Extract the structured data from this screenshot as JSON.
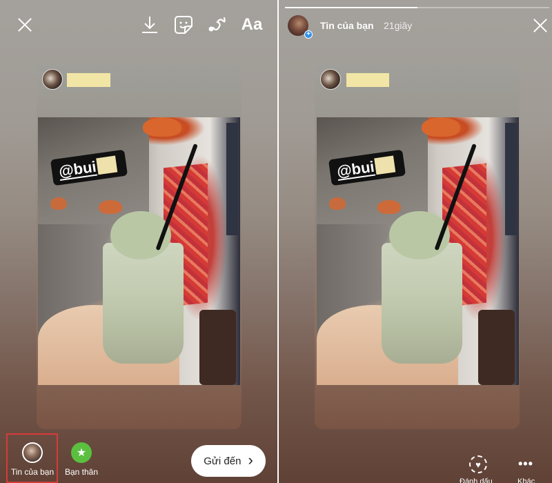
{
  "left": {
    "toolbar": {
      "close": "close-icon",
      "download": "download-icon",
      "sticker": "sticker-icon",
      "draw": "draw-icon",
      "text_label": "Aa"
    },
    "card": {
      "mention_prefix": "@bui"
    },
    "bottom": {
      "your_story_label": "Tin của bạn",
      "close_friends_label": "Bạn thân",
      "close_friends_icon": "★",
      "send_label": "Gửi đến",
      "send_chevron": "›"
    }
  },
  "right": {
    "header": {
      "username": "Tin của bạn",
      "time": "21giây",
      "progress": 0.5,
      "plus": "+"
    },
    "card": {
      "mention_prefix": "@bui"
    },
    "bottom": {
      "highlight_label": "Đánh dấu",
      "more_label": "Khác",
      "more_dots": "•••",
      "heart": "♥"
    }
  },
  "colors": {
    "highlight_border": "#d83a3a",
    "close_friends_green": "#5bbf3f",
    "redact_yellow": "#f2e6a6",
    "plus_badge_blue": "#2f8fea"
  }
}
